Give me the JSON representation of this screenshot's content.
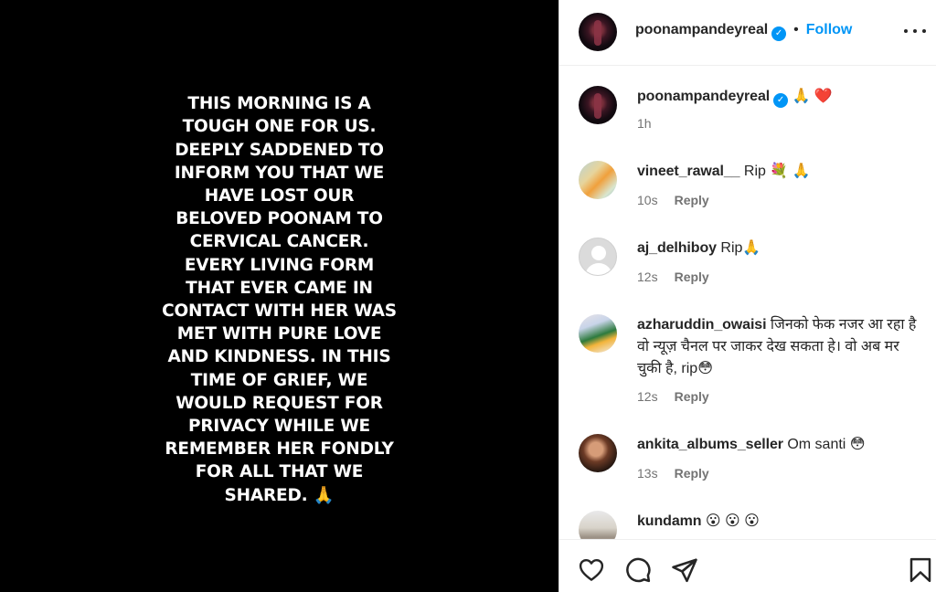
{
  "post": {
    "text_lines": [
      "THIS MORNING IS A",
      "TOUGH ONE FOR US.",
      "DEEPLY SADDENED TO",
      "INFORM YOU THAT WE",
      "HAVE LOST OUR",
      "BELOVED POONAM TO",
      "CERVICAL CANCER.",
      "EVERY LIVING FORM",
      "THAT EVER CAME IN",
      "CONTACT WITH HER WAS",
      "MET WITH PURE LOVE",
      "AND KINDNESS. IN THIS",
      "TIME OF GRIEF, WE",
      "WOULD REQUEST FOR",
      "PRIVACY WHILE WE",
      "REMEMBER HER FONDLY",
      "FOR ALL THAT WE",
      "SHARED. 🙏"
    ]
  },
  "header": {
    "username": "poonampandeyreal",
    "separator": "•",
    "follow_label": "Follow",
    "verified_mark": "✓"
  },
  "caption": {
    "username": "poonampandeyreal",
    "text": "🙏 ❤️",
    "time": "1h"
  },
  "comments": [
    {
      "username": "vineet_rawal__",
      "text": "Rip 💐 🙏",
      "time": "10s",
      "reply": "Reply"
    },
    {
      "username": "aj_delhiboy",
      "text": "Rip🙏",
      "time": "12s",
      "reply": "Reply"
    },
    {
      "username": "azharuddin_owaisi",
      "text": "जिनको फेक नजर आ रहा है वो न्यूज़ चैनल पर जाकर देख सकता हे। वो अब मर चुकी है, rip😳",
      "time": "12s",
      "reply": "Reply"
    },
    {
      "username": "ankita_albums_seller",
      "text": "Om santi 😳",
      "time": "13s",
      "reply": "Reply"
    },
    {
      "username": "kundamn",
      "text": "😮 😮 😮",
      "time": "",
      "reply": ""
    }
  ],
  "icons": {
    "like": "heart-icon",
    "comment": "comment-icon",
    "share": "share-icon",
    "save": "bookmark-icon",
    "more": "more-options-icon"
  },
  "colors": {
    "accent": "#0095f6",
    "meta": "#737373",
    "text": "#262626"
  }
}
